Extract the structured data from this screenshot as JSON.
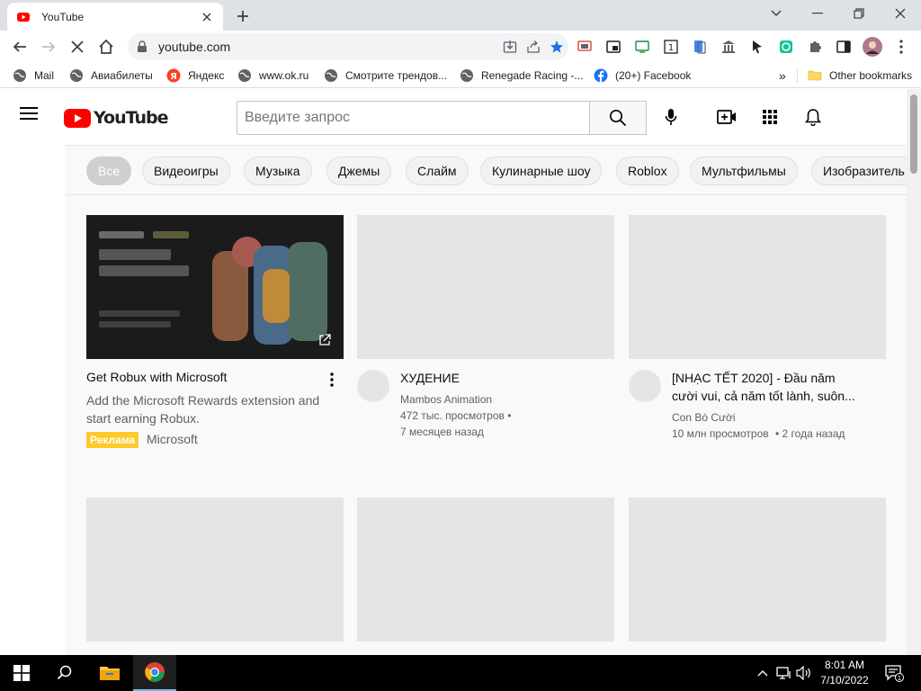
{
  "browser": {
    "tab_title": "YouTube",
    "url": "youtube.com",
    "bookmarks": [
      {
        "label": "Mail",
        "icon": "globe-icon"
      },
      {
        "label": "Авиабилеты",
        "icon": "globe-icon"
      },
      {
        "label": "Яндекс",
        "icon": "yandex-icon"
      },
      {
        "label": "www.ok.ru",
        "icon": "globe-icon"
      },
      {
        "label": "Смотрите трендов...",
        "icon": "globe-icon"
      },
      {
        "label": "Renegade Racing -...",
        "icon": "globe-icon"
      },
      {
        "label": "(20+) Facebook",
        "icon": "facebook-icon"
      }
    ],
    "bookmarks_overflow": "»",
    "other_bookmarks": "Other bookmarks",
    "colors": {
      "titlebar": "#dee1e6",
      "accent_star": "#1a73e8"
    }
  },
  "youtube": {
    "logo_text": "YouTube",
    "search_placeholder": "Введите запрос",
    "chips": [
      "Все",
      "Видеоигры",
      "Музыка",
      "Джемы",
      "Слайм",
      "Кулинарные шоу",
      "Roblox",
      "Мультфильмы",
      "Изобразитель"
    ],
    "ad": {
      "title": "Get Robux with Microsoft",
      "description": "Add the Microsoft Rewards extension and start earning Robux.",
      "badge": "Реклама",
      "advertiser": "Microsoft"
    },
    "videos": [
      {
        "title": "ХУДЕНИЕ",
        "title_line2": "",
        "channel": "Mambos Animation",
        "views": "472 тыс. просмотров •",
        "age": "7 месяцев назад"
      },
      {
        "title": "[NHẠC TẾT 2020] - Đầu năm",
        "title_line2": "cười vui, cả năm tốt lành, suôn...",
        "channel": "Con Bò Cười",
        "views": "10 млн просмотров",
        "age": "• 2 года назад"
      }
    ],
    "colors": {
      "brand_red": "#ff0000",
      "placeholder_gray": "#e5e5e5",
      "ad_badge": "#ffca28"
    }
  },
  "taskbar": {
    "time": "8:01 AM",
    "date": "7/10/2022",
    "notification_count": "1"
  }
}
